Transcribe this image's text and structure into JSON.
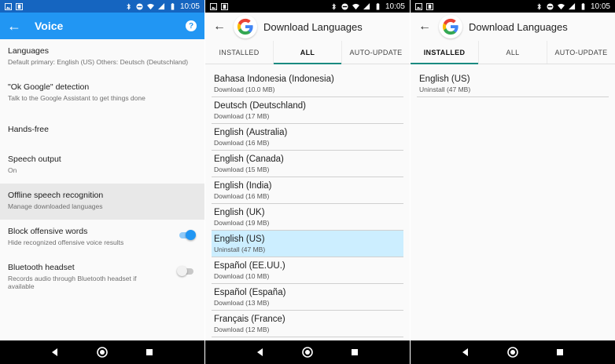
{
  "status": {
    "time": "10:05"
  },
  "voice": {
    "title": "Voice",
    "help_glyph": "?",
    "settings": [
      {
        "title": "Languages",
        "subtitle": "Default primary: English (US) Others: Deutsch (Deutschland)"
      },
      {
        "title": "\"Ok Google\" detection",
        "subtitle": "Talk to the Google Assistant to get things done"
      },
      {
        "title": "Hands-free",
        "subtitle": ""
      },
      {
        "title": "Speech output",
        "subtitle": "On"
      },
      {
        "title": "Offline speech recognition",
        "subtitle": "Manage downloaded languages"
      },
      {
        "title": "Block offensive words",
        "subtitle": "Hide recognized offensive voice results",
        "toggle": "on"
      },
      {
        "title": "Bluetooth headset",
        "subtitle": "Records audio through Bluetooth headset if available",
        "toggle": "off"
      }
    ]
  },
  "download_all": {
    "title": "Download Languages",
    "tabs": [
      "INSTALLED",
      "ALL",
      "AUTO-UPDATE"
    ],
    "active_tab": "ALL",
    "languages": [
      {
        "name": "Bahasa Indonesia (Indonesia)",
        "action": "Download (10.0 MB)"
      },
      {
        "name": "Deutsch (Deutschland)",
        "action": "Download (17 MB)"
      },
      {
        "name": "English (Australia)",
        "action": "Download (16 MB)"
      },
      {
        "name": "English (Canada)",
        "action": "Download (15 MB)"
      },
      {
        "name": "English (India)",
        "action": "Download (16 MB)"
      },
      {
        "name": "English (UK)",
        "action": "Download (19 MB)"
      },
      {
        "name": "English (US)",
        "action": "Uninstall (47 MB)"
      },
      {
        "name": "Español (EE.UU.)",
        "action": "Download (10 MB)"
      },
      {
        "name": "Español (España)",
        "action": "Download (13 MB)"
      },
      {
        "name": "Français (France)",
        "action": "Download (12 MB)"
      }
    ]
  },
  "download_installed": {
    "title": "Download Languages",
    "tabs": [
      "INSTALLED",
      "ALL",
      "AUTO-UPDATE"
    ],
    "active_tab": "INSTALLED",
    "languages": [
      {
        "name": "English (US)",
        "action": "Uninstall (47 MB)"
      }
    ]
  },
  "colors": {
    "appbar": "#2196f3",
    "status_blue": "#1565c0",
    "tab_indicator": "#1a8a80",
    "highlight_row": "#cceeff",
    "google_blue": "#4285F4",
    "google_red": "#EA4335",
    "google_yellow": "#FBBC05",
    "google_green": "#34A853"
  }
}
